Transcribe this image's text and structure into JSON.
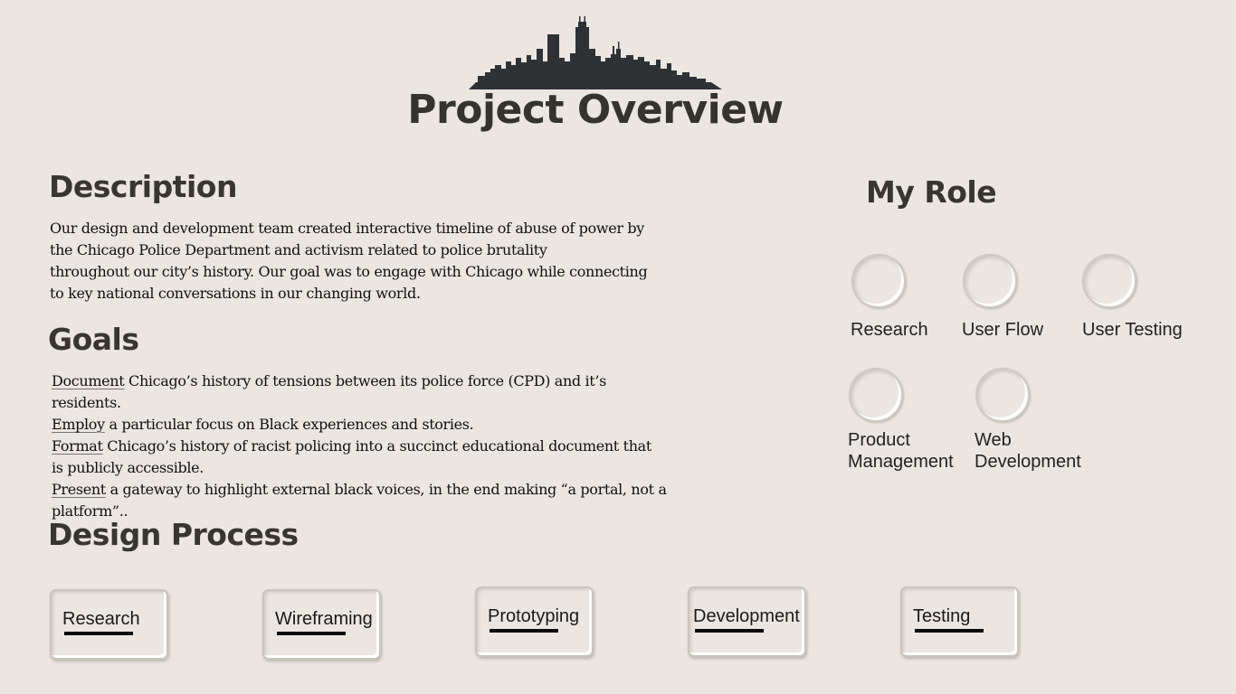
{
  "header": {
    "title": "Project Overview",
    "logo_icon": "chicago-skyline-icon"
  },
  "description": {
    "heading": "Description",
    "lines": [
      "Our design and development team created interactive timeline of abuse of power by",
      "the Chicago Police Department and activism related to police brutality",
      "throughout our city’s history. Our goal was to engage with Chicago while connecting",
      "to key national conversations in our changing world."
    ]
  },
  "goals": {
    "heading": "Goals",
    "items": [
      {
        "verb": "Document",
        "text": " Chicago’s history of tensions between its police force (CPD) and it’s residents."
      },
      {
        "verb": "Employ",
        "text": " a particular focus on Black experiences and stories."
      },
      {
        "verb": "Format",
        "text": " Chicago’s history of racist policing into a succinct educational document that is publicly accessible."
      },
      {
        "verb": "Present",
        "text": " a gateway to highlight external black voices, in the end making “a portal, not a platform”.."
      }
    ]
  },
  "role": {
    "heading": "My Role",
    "items": [
      {
        "label": "Research"
      },
      {
        "label": "User Flow"
      },
      {
        "label": "User Testing"
      },
      {
        "label": "Product\nManagement"
      },
      {
        "label": "Web\nDevelopment"
      }
    ]
  },
  "design_process": {
    "heading": "Design Process",
    "steps": [
      {
        "label": "Research"
      },
      {
        "label": "Wireframing"
      },
      {
        "label": "Prototyping"
      },
      {
        "label": "Development"
      },
      {
        "label": "Testing"
      }
    ]
  },
  "colors": {
    "background": "#ebe6e1",
    "heading": "#35332e",
    "skyline": "#2e3235"
  }
}
